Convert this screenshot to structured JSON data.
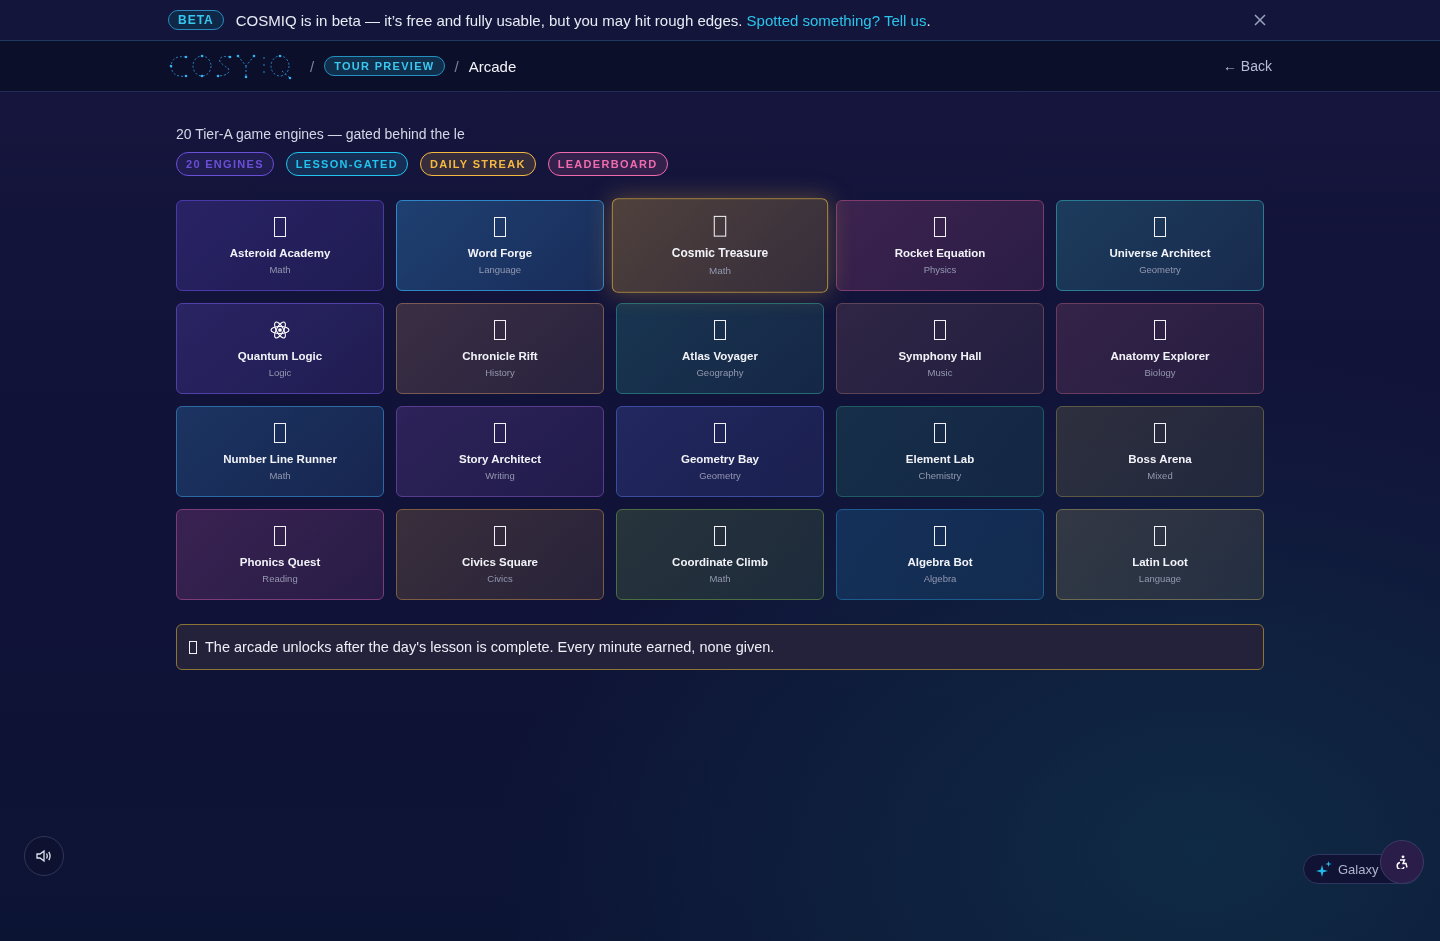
{
  "beta_banner": {
    "badge": "BETA",
    "message": "COSMIQ is in beta — it’s free and fully usable, but you may hit rough edges.",
    "link": "Spotted something? Tell us",
    "end": "."
  },
  "header": {
    "breadcrumb_separator_1": "/",
    "tour_badge": "TOUR PREVIEW",
    "breadcrumb_separator_2": "/",
    "page": "Arcade",
    "back": "← Back"
  },
  "intro": "20 Tier-A game engines — gated behind the le",
  "tags": [
    {
      "label": "20 ENGINES",
      "color": "#6a4fd8"
    },
    {
      "label": "LESSON-GATED",
      "color": "#22c3ee"
    },
    {
      "label": "DAILY STREAK",
      "color": "#f5b942"
    },
    {
      "label": "LEADERBOARD",
      "color": "#f06bae"
    }
  ],
  "games": [
    {
      "title": "Asteroid Academy",
      "subject": "Math",
      "kind": "glyph",
      "color": "#4a3aa8",
      "selected": false
    },
    {
      "title": "Word Forge",
      "subject": "Language",
      "kind": "glyph",
      "color": "#2f86c8",
      "selected": false
    },
    {
      "title": "Cosmic Treasure",
      "subject": "Math",
      "kind": "glyph",
      "color": "#b08a3e",
      "selected": true
    },
    {
      "title": "Rocket Equation",
      "subject": "Physics",
      "kind": "glyph",
      "color": "#7e3c6e",
      "selected": false
    },
    {
      "title": "Universe Architect",
      "subject": "Geometry",
      "kind": "glyph",
      "color": "#2a7c92",
      "selected": false
    },
    {
      "title": "Quantum Logic",
      "subject": "Logic",
      "kind": "atom",
      "color": "#4f3fa6",
      "selected": false
    },
    {
      "title": "Chronicle Rift",
      "subject": "History",
      "kind": "glyph",
      "color": "#7a5a52",
      "selected": false
    },
    {
      "title": "Atlas Voyager",
      "subject": "Geography",
      "kind": "glyph",
      "color": "#226c74",
      "selected": false
    },
    {
      "title": "Symphony Hall",
      "subject": "Music",
      "kind": "glyph",
      "color": "#5e4456",
      "selected": false
    },
    {
      "title": "Anatomy Explorer",
      "subject": "Biology",
      "kind": "glyph",
      "color": "#6c3c5e",
      "selected": false
    },
    {
      "title": "Number Line Runner",
      "subject": "Math",
      "kind": "glyph",
      "color": "#2c6aa4",
      "selected": false
    },
    {
      "title": "Story Architect",
      "subject": "Writing",
      "kind": "glyph",
      "color": "#5a3c8e",
      "selected": false
    },
    {
      "title": "Geometry Bay",
      "subject": "Geometry",
      "kind": "glyph",
      "color": "#3c4c9e",
      "selected": false
    },
    {
      "title": "Element Lab",
      "subject": "Chemistry",
      "kind": "glyph",
      "color": "#1e5c64",
      "selected": false
    },
    {
      "title": "Boss Arena",
      "subject": "Mixed",
      "kind": "glyph",
      "color": "#5c5a44",
      "selected": false
    },
    {
      "title": "Phonics Quest",
      "subject": "Reading",
      "kind": "glyph",
      "color": "#7c3c7c",
      "selected": false
    },
    {
      "title": "Civics Square",
      "subject": "Civics",
      "kind": "glyph",
      "color": "#7c5c42",
      "selected": false
    },
    {
      "title": "Coordinate Climb",
      "subject": "Math",
      "kind": "glyph",
      "color": "#4c6c42",
      "selected": false
    },
    {
      "title": "Algebra Bot",
      "subject": "Algebra",
      "kind": "glyph",
      "color": "#1c5c8e",
      "selected": false
    },
    {
      "title": "Latin Loot",
      "subject": "Language",
      "kind": "glyph",
      "color": "#6c6a52",
      "selected": false
    }
  ],
  "notice": "The arcade unlocks after the day's lesson is complete. Every minute earned, none given.",
  "galaxy_button": "Galaxy"
}
